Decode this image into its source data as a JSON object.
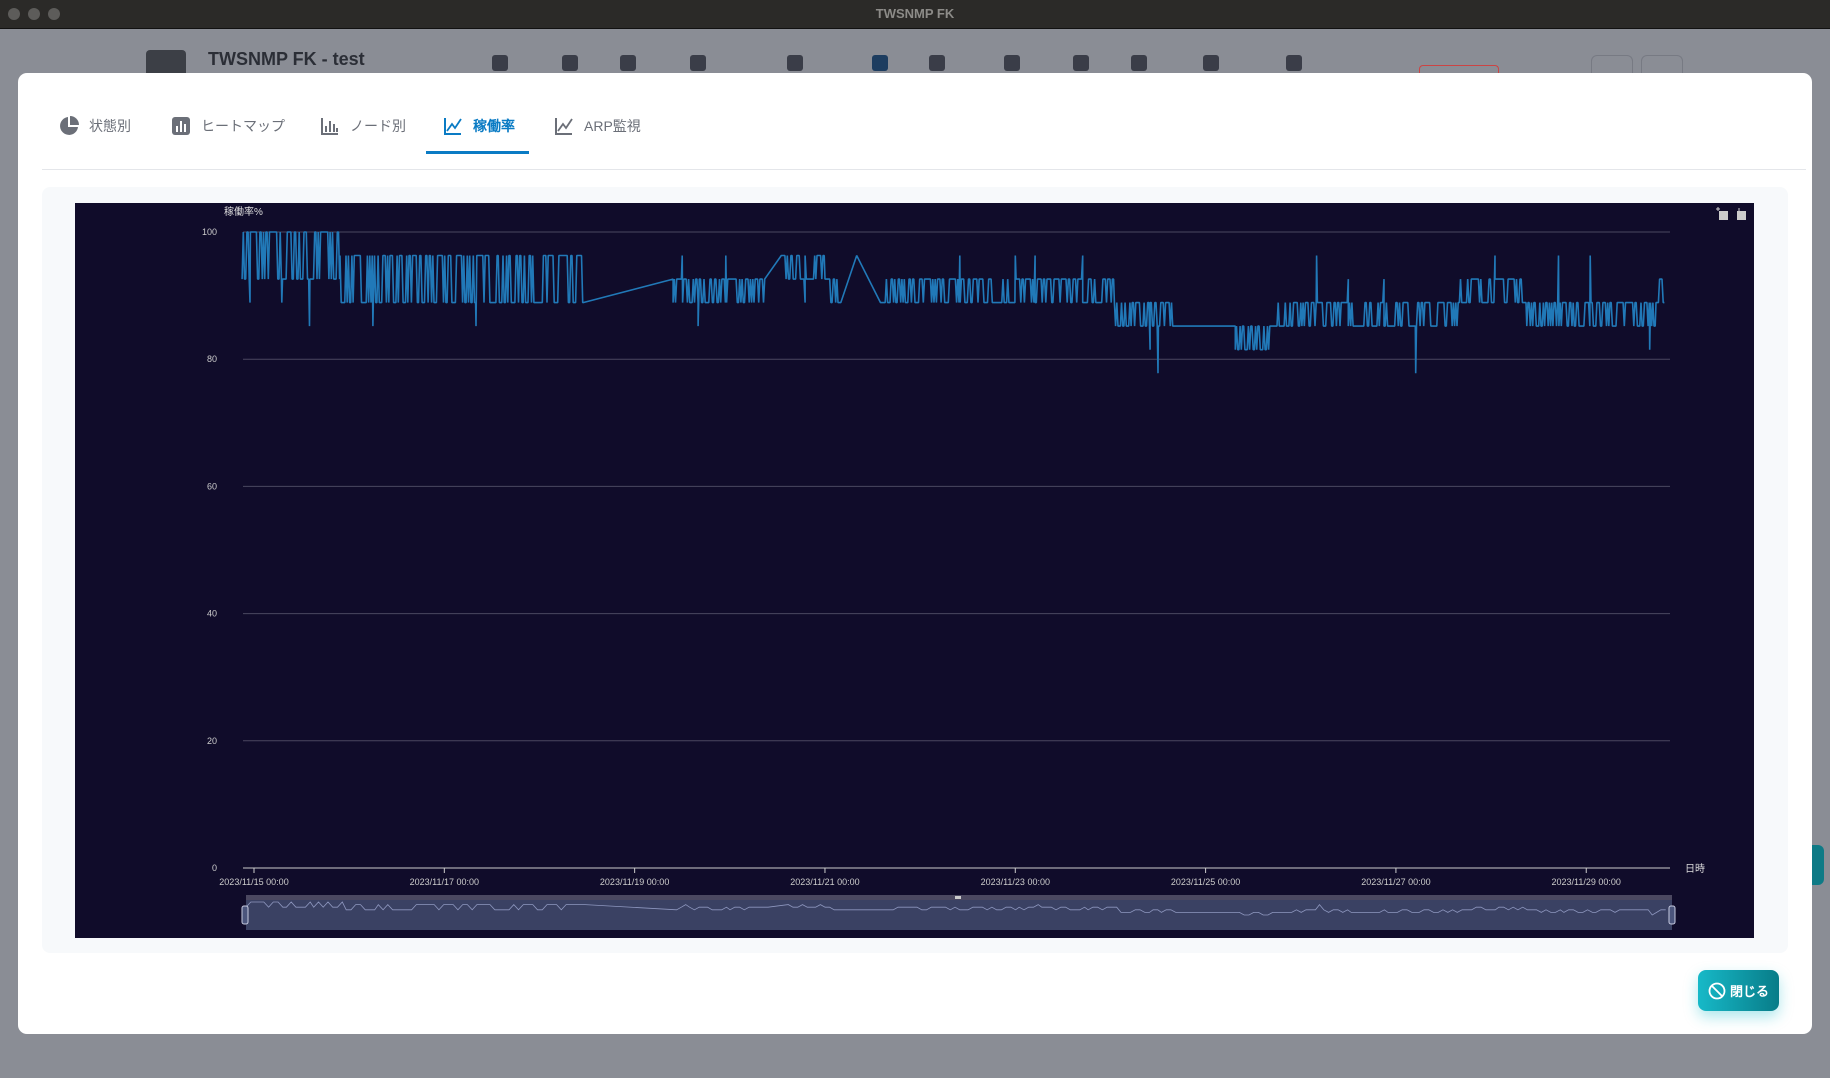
{
  "window": {
    "title": "TWSNMP FK"
  },
  "background_app": {
    "title": "TWSNMP FK - test"
  },
  "tabs": [
    {
      "label": "状態別",
      "icon": "pie-chart-icon",
      "active": false
    },
    {
      "label": "ヒートマップ",
      "icon": "heatmap-icon",
      "active": false
    },
    {
      "label": "ノード別",
      "icon": "bar-chart-icon",
      "active": false
    },
    {
      "label": "稼働率",
      "icon": "line-chart-icon",
      "active": true
    },
    {
      "label": "ARP監視",
      "icon": "line-chart-icon",
      "active": false
    }
  ],
  "buttons": {
    "close_label": "閉じる"
  },
  "colors": {
    "accent": "#0a7bc4",
    "chart_bg": "#100c2a",
    "series": "#2179b8",
    "close_btn": "#10a6b4"
  },
  "chart_data": {
    "type": "line",
    "ylabel": "稼働率%",
    "xlabel": "日時",
    "ylim": [
      0,
      100
    ],
    "y_ticks": [
      0,
      20,
      40,
      60,
      80,
      100
    ],
    "x_origin": "2023/11/15 00:00",
    "x_unit": "hours since x_origin",
    "xlim": [
      -3,
      357
    ],
    "x_ticks": [
      {
        "h": 0,
        "label": "2023/11/15 00:00"
      },
      {
        "h": 48,
        "label": "2023/11/17 00:00"
      },
      {
        "h": 96,
        "label": "2023/11/19 00:00"
      },
      {
        "h": 144,
        "label": "2023/11/21 00:00"
      },
      {
        "h": 192,
        "label": "2023/11/23 00:00"
      },
      {
        "h": 240,
        "label": "2023/11/25 00:00"
      },
      {
        "h": 288,
        "label": "2023/11/27 00:00"
      },
      {
        "h": 336,
        "label": "2023/11/29 00:00"
      }
    ],
    "series_name": "稼働率",
    "dense_segments_note": "each segment: [from_h, to_h, low_value, high_value] — values oscillate between low and high",
    "dense_segments": [
      [
        -3,
        21.7,
        92.6,
        100
      ],
      [
        21.7,
        40,
        88.9,
        96.3
      ],
      [
        40,
        83,
        88.9,
        96.3
      ],
      [
        105.7,
        129,
        88.9,
        92.6
      ],
      [
        133,
        144,
        92.6,
        96.3
      ],
      [
        144,
        148,
        88.9,
        92.6
      ],
      [
        158,
        217,
        88.9,
        92.6
      ],
      [
        217,
        232,
        85.2,
        88.9
      ],
      [
        247.5,
        258,
        81.5,
        85.2
      ],
      [
        258,
        292,
        85.2,
        88.9
      ],
      [
        292,
        304,
        85.2,
        88.9
      ],
      [
        304,
        321,
        88.9,
        92.6
      ],
      [
        321,
        353.6,
        85.2,
        88.9
      ],
      [
        353.6,
        356,
        88.9,
        92.6
      ]
    ],
    "flat_segments": [
      [
        83,
        88.9,
        105.7,
        92.6
      ],
      [
        148,
        88.9,
        158,
        88.9
      ],
      [
        232,
        85.2,
        247.5,
        85.2
      ]
    ],
    "spikes": [
      [
        -1,
        88.9
      ],
      [
        7,
        88.9
      ],
      [
        14,
        85.2
      ],
      [
        30,
        85.2
      ],
      [
        56,
        85.2
      ],
      [
        108,
        96.3
      ],
      [
        112,
        85.2
      ],
      [
        119,
        96.3
      ],
      [
        139,
        88.9
      ],
      [
        152,
        96.3
      ],
      [
        178,
        96.3
      ],
      [
        192,
        96.3
      ],
      [
        197,
        96.3
      ],
      [
        209,
        96.3
      ],
      [
        226,
        81.5
      ],
      [
        228,
        77.8
      ],
      [
        268,
        96.3
      ],
      [
        276,
        92.6
      ],
      [
        285,
        92.6
      ],
      [
        293,
        77.8
      ],
      [
        313,
        96.3
      ],
      [
        329,
        96.3
      ],
      [
        337,
        96.3
      ],
      [
        352,
        81.5
      ]
    ]
  }
}
